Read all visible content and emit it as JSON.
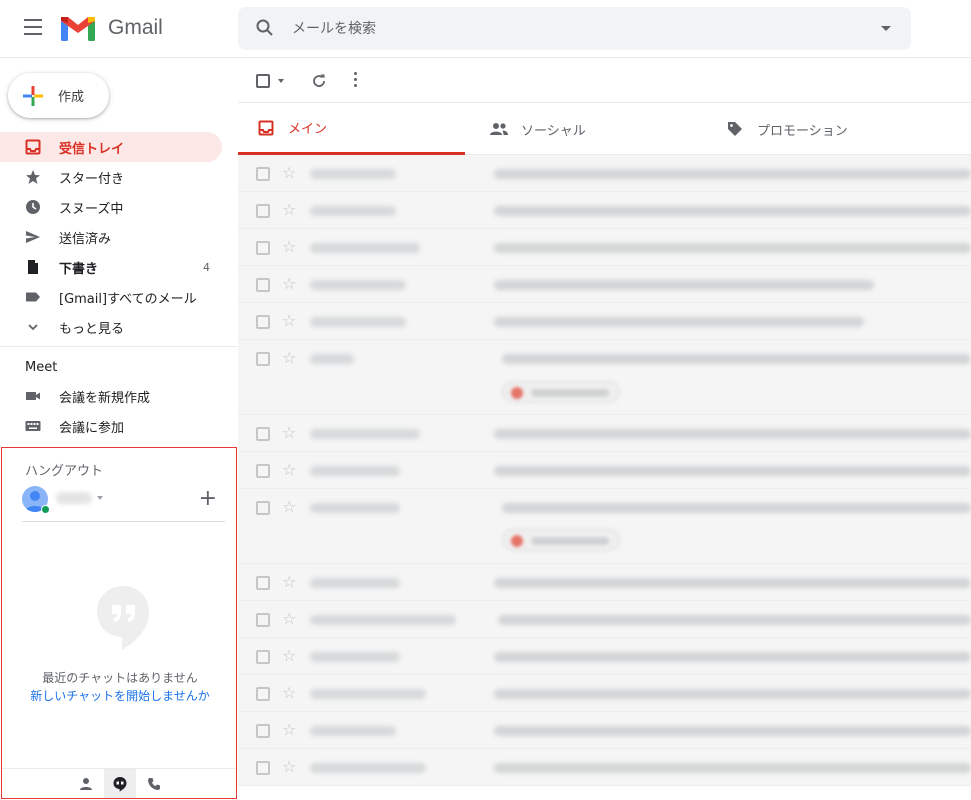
{
  "app": {
    "name": "Gmail"
  },
  "colors": {
    "brand_red": "#d93025",
    "active_bg": "#fce8e6",
    "link_blue": "#1a73e8",
    "hangouts_border": "#e53935"
  },
  "search": {
    "placeholder": "メールを検索"
  },
  "compose": {
    "label": "作成"
  },
  "nav": {
    "items": [
      {
        "label": "受信トレイ",
        "icon": "inbox-icon",
        "active": true
      },
      {
        "label": "スター付き",
        "icon": "star-icon"
      },
      {
        "label": "スヌーズ中",
        "icon": "clock-icon"
      },
      {
        "label": "送信済み",
        "icon": "send-icon"
      },
      {
        "label": "下書き",
        "icon": "draft-icon",
        "count": "4",
        "bold": true
      },
      {
        "label": "[Gmail]すべてのメール",
        "icon": "label-icon"
      },
      {
        "label": "もっと見る",
        "icon": "chevron-down-icon"
      }
    ]
  },
  "meet": {
    "title": "Meet",
    "items": [
      {
        "label": "会議を新規作成",
        "icon": "video-icon"
      },
      {
        "label": "会議に参加",
        "icon": "keyboard-icon"
      }
    ]
  },
  "hangouts": {
    "title": "ハングアウト",
    "empty_text": "最近のチャットはありません",
    "start_link": "新しいチャットを開始しませんか",
    "bottom_icons": [
      "person-icon",
      "hangouts-icon",
      "phone-icon"
    ]
  },
  "tabs": [
    {
      "label": "メイン",
      "icon": "inbox-icon",
      "active": true
    },
    {
      "label": "ソーシャル",
      "icon": "people-icon"
    },
    {
      "label": "プロモーション",
      "icon": "tag-icon"
    }
  ]
}
